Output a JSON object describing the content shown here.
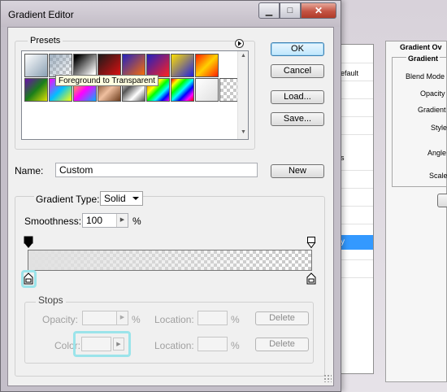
{
  "window": {
    "title": "Gradient Editor",
    "controls": {
      "minimize": "▁",
      "maximize": "□",
      "close": "✕"
    }
  },
  "presets": {
    "label": "Presets",
    "menu_icon": "circle-arrow-right-icon",
    "tooltip": "Foreground to Transparent"
  },
  "buttons": {
    "ok": "OK",
    "cancel": "Cancel",
    "load": "Load...",
    "save": "Save...",
    "new": "New",
    "delete_opacity": "Delete",
    "delete_color": "Delete"
  },
  "name_field": {
    "label": "Name:",
    "value": "Custom"
  },
  "gradient_type": {
    "label": "Gradient Type:",
    "value": "Solid"
  },
  "smoothness": {
    "label": "Smoothness:",
    "value": "100",
    "unit": "%"
  },
  "stops": {
    "label": "Stops",
    "opacity_label": "Opacity:",
    "opacity_unit": "%",
    "opacity_location_label": "Location:",
    "opacity_location_unit": "%",
    "color_label": "Color:",
    "color_location_label": "Location:",
    "color_location_unit": "%"
  },
  "background_dialog": {
    "title": "Gradient Ov",
    "group_title": "Gradient",
    "list_item_1": "efault",
    "list_item_2": "s",
    "list_item_selected": "y",
    "blend_mode": "Blend Mode",
    "opacity": "Opacity",
    "gradient": "Gradient",
    "style": "Style",
    "angle": "Angle",
    "scale": "Scale"
  },
  "colors": {
    "highlight": "#9be4ea",
    "selection": "#3399ff"
  }
}
